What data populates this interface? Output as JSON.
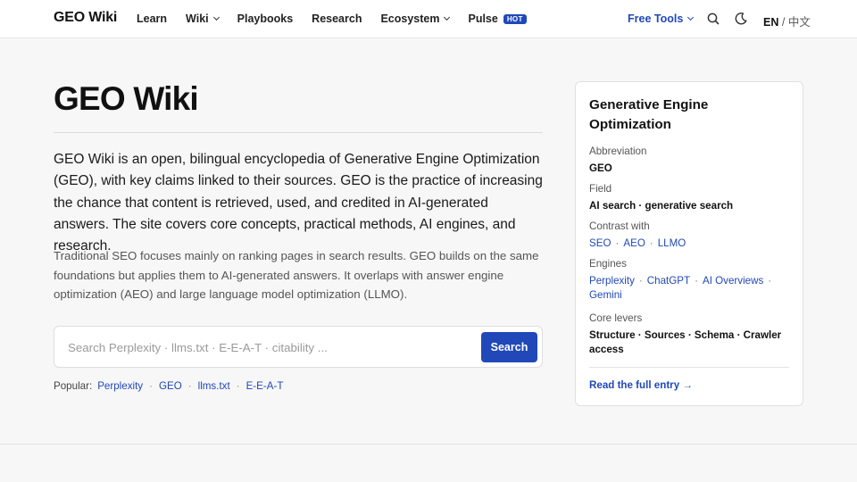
{
  "header": {
    "brand": "GEO Wiki",
    "nav": [
      {
        "label": "Learn"
      },
      {
        "label": "Wiki"
      },
      {
        "label": "Playbooks"
      },
      {
        "label": "Research"
      },
      {
        "label": "Ecosystem"
      },
      {
        "label": "Pulse",
        "badge": "HOT"
      }
    ],
    "free_tools": "Free Tools",
    "lang_active": "EN",
    "lang_sep": "/",
    "lang_other": "中文",
    "icons": [
      "search-icon",
      "moon-icon"
    ],
    "accent": "#2148b8"
  },
  "main": {
    "title": "GEO Wiki",
    "lead": "GEO Wiki is an open, bilingual encyclopedia of Generative Engine Optimization (GEO), with key claims linked to their sources. GEO is the practice of increasing the chance that content is retrieved, used, and credited in AI-generated answers. The site covers core concepts, practical methods, AI engines, and research.",
    "sub": "Traditional SEO focuses mainly on ranking pages in search results. GEO builds on the same foundations but applies them to AI-generated answers. It overlaps with answer engine optimization (AEO) and large language model optimization (LLMO).",
    "search": {
      "placeholder": "Search Perplexity · llms.txt · E-E-A-T · citability ...",
      "value": "",
      "button": "Search"
    },
    "popular": {
      "label": "Popular:",
      "items": [
        "Perplexity",
        "GEO",
        "llms.txt",
        "E-E-A-T"
      ]
    }
  },
  "infobox": {
    "title": "Generative Engine Optimization",
    "abbreviation_label": "Abbreviation",
    "abbreviation": "GEO",
    "field_label": "Field",
    "field": "AI search · generative search",
    "contrast_label": "Contrast with",
    "contrast": [
      "SEO",
      "AEO",
      "LLMO"
    ],
    "engines_label": "Engines",
    "engines": [
      "Perplexity",
      "ChatGPT",
      "AI Overviews",
      "Gemini"
    ],
    "levers_label": "Core levers",
    "levers": "Structure · Sources · Schema · Crawler access",
    "read_more": "Read the full entry →"
  }
}
